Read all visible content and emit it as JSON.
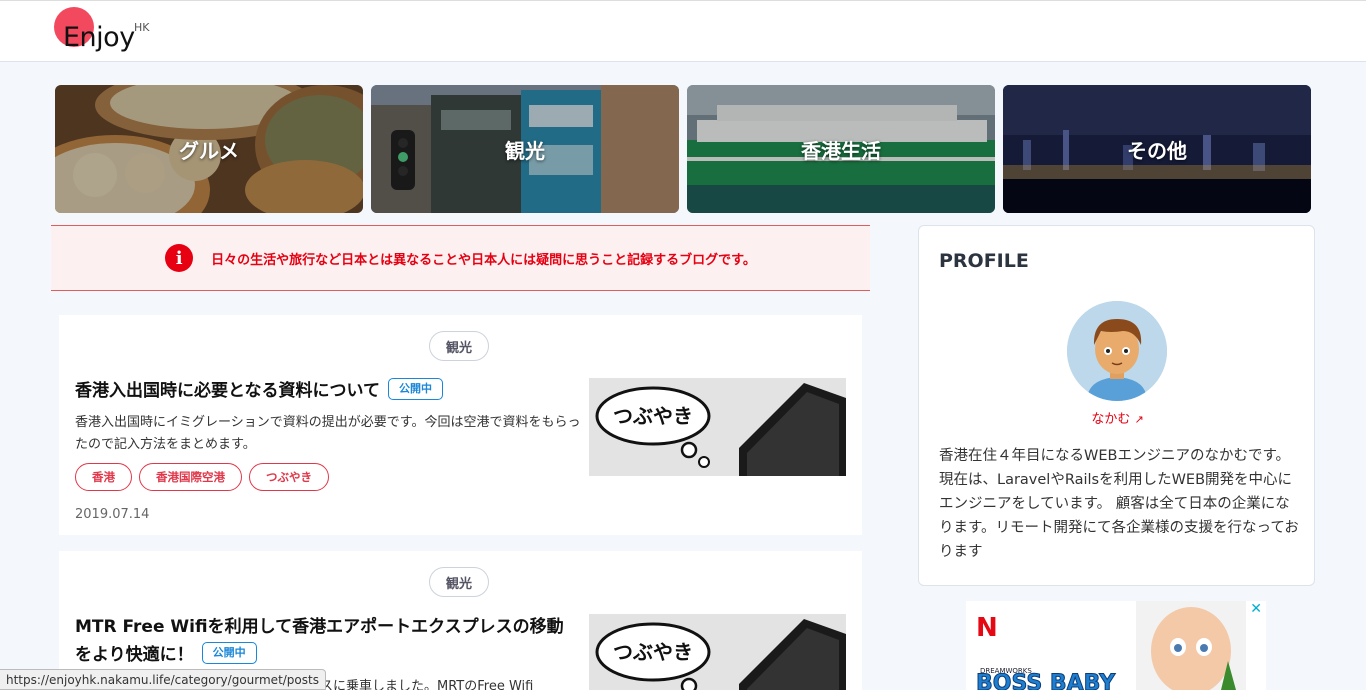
{
  "header": {
    "logo_text": "Enjoy",
    "logo_sup": "HK"
  },
  "categories": [
    {
      "label": "グルメ"
    },
    {
      "label": "観光"
    },
    {
      "label": "香港生活"
    },
    {
      "label": "その他"
    }
  ],
  "notice": {
    "icon": "i",
    "text": "日々の生活や旅行など日本とは異なることや日本人には疑問に思うこと記録するブログです。"
  },
  "posts": [
    {
      "category": "観光",
      "title": "香港入出国時に必要となる資料について",
      "badge": "公開中",
      "excerpt": "香港入出国時にイミグレーションで資料の提出が必要です。今回は空港で資料をもらったので記入方法をまとめます。",
      "tags": [
        "香港",
        "香港国際空港",
        "つぶやき"
      ],
      "date": "2019.07.14",
      "thumb_text": "つぶやき"
    },
    {
      "category": "観光",
      "title": "MTR Free Wifiを利用して香港エアポートエクスプレスの移動をより快適に！",
      "badge": "公開中",
      "excerpt": "スプレスに乗車しました。MRTのFree Wifi",
      "thumb_text": "つぶやき"
    }
  ],
  "profile": {
    "title": "PROFILE",
    "name": "なかむ",
    "bio": "香港在住４年目になるWEBエンジニアのなかむです。 現在は、LaravelやRailsを利用したWEB開発を中心にエンジニアをしています。 顧客は全て日本の企業になります。リモート開発にて各企業様の支援を行なっております"
  },
  "ad": {
    "brand": "N",
    "title": "BOSS BABY",
    "studio": "DREAMWORKS",
    "close": "✕"
  },
  "statusbar": {
    "url": "https://enjoyhk.nakamu.life/category/gourmet/posts"
  },
  "colors": {
    "accent": "#e60012",
    "badge_blue": "#1a87d8",
    "logo_dot": "#f2495e"
  }
}
